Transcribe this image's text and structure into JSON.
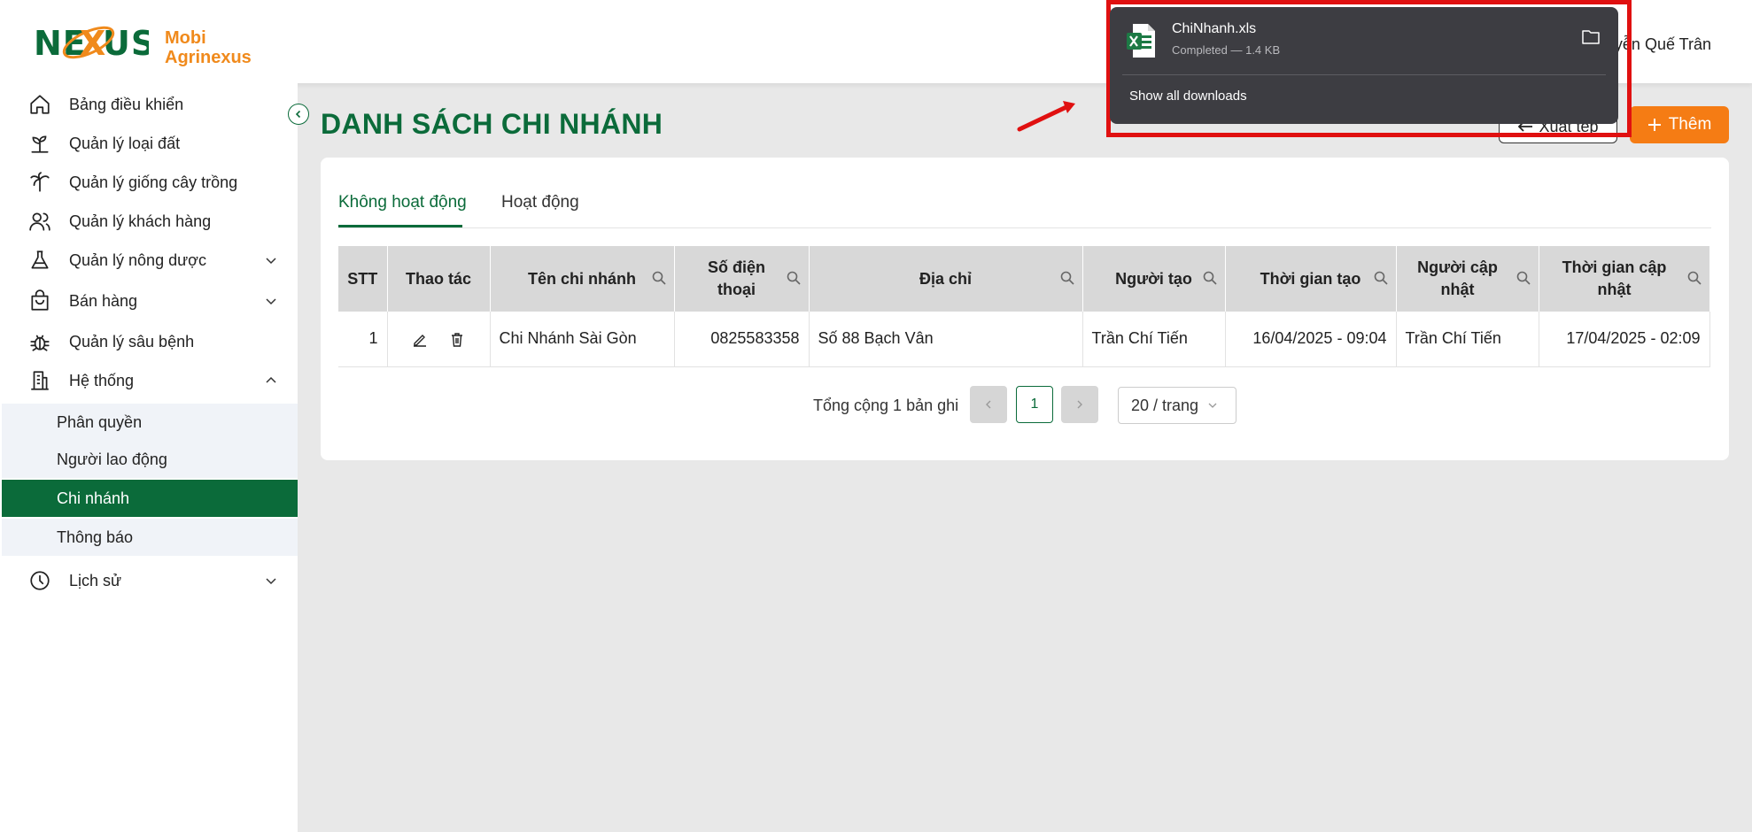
{
  "brand": {
    "logo_word": "NEXUS",
    "line1": "Mobi",
    "line2": "Agrinexus"
  },
  "user": {
    "name": "yễn Quế Trân"
  },
  "sidebar": {
    "items": [
      {
        "label": "Bảng điều khiển",
        "icon": "home-icon"
      },
      {
        "label": "Quản lý loại đất",
        "icon": "sprout-icon"
      },
      {
        "label": "Quản lý giống cây trồng",
        "icon": "palm-tree-icon"
      },
      {
        "label": "Quản lý khách hàng",
        "icon": "users-icon"
      },
      {
        "label": "Quản lý nông dược",
        "icon": "flask-icon"
      },
      {
        "label": "Bán hàng",
        "icon": "shopping-bag-icon"
      },
      {
        "label": "Quản lý sâu bệnh",
        "icon": "bug-icon"
      },
      {
        "label": "Hệ thống",
        "icon": "building-icon"
      },
      {
        "label": "Lịch sử",
        "icon": "clock-icon"
      }
    ],
    "sub_items": [
      "Phân quyền",
      "Người lao động",
      "Chi nhánh",
      "Thông báo"
    ],
    "active_sub": "Chi nhánh"
  },
  "page": {
    "title": "DANH SÁCH CHI NHÁNH",
    "export_label": "Xuất tệp",
    "add_label": "Thêm"
  },
  "tabs": [
    "Không hoạt động",
    "Hoạt động"
  ],
  "active_tab": "Không hoạt động",
  "table": {
    "headers": [
      "STT",
      "Thao tác",
      "Tên chi nhánh",
      "Số điện thoại",
      "Địa chỉ",
      "Người tạo",
      "Thời gian tạo",
      "Người cập nhật",
      "Thời gian cập nhật"
    ],
    "rows": [
      {
        "stt": "1",
        "name": "Chi Nhánh Sài Gòn",
        "phone": "0825583358",
        "address": "Số 88 Bạch Vân",
        "created_by": "Trần Chí Tiến",
        "created_at": "16/04/2025 - 09:04",
        "updated_by": "Trần Chí Tiến",
        "updated_at": "17/04/2025 - 02:09"
      }
    ]
  },
  "pagination": {
    "total_text": "Tổng cộng 1 bản ghi",
    "current": "1",
    "page_size": "20 / trang"
  },
  "download": {
    "file_name": "ChiNhanh.xls",
    "status": "Completed — 1.4 KB",
    "show_all": "Show all downloads"
  },
  "colors": {
    "brand_green": "#0b6b3a",
    "brand_orange": "#f57c14",
    "highlight_red": "#e01010"
  }
}
